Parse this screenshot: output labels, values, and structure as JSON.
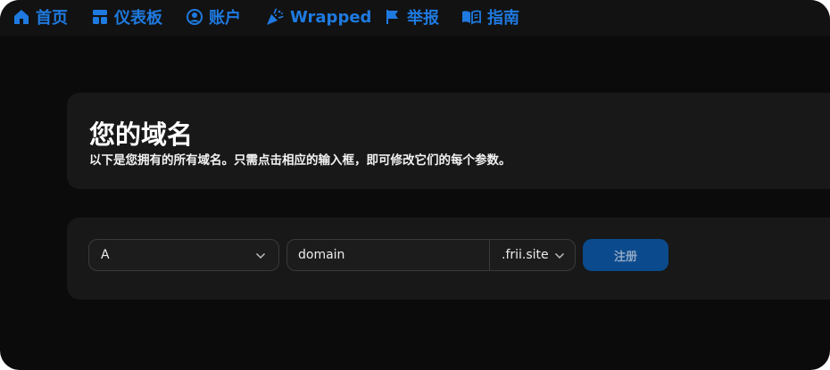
{
  "nav": {
    "items": [
      {
        "label": "首页",
        "icon": "home-icon"
      },
      {
        "label": "仪表板",
        "icon": "dashboard-icon"
      },
      {
        "label": "账户",
        "icon": "account-icon"
      },
      {
        "label": "Wrapped",
        "icon": "party-popper-icon"
      },
      {
        "label": "举报",
        "icon": "flag-icon"
      },
      {
        "label": "指南",
        "icon": "book-icon"
      }
    ]
  },
  "header": {
    "title": "您的域名",
    "description": "以下是您拥有的所有域名。只需点击相应的输入框，即可修改它们的每个参数。"
  },
  "form": {
    "record_type": "A",
    "domain_value": "domain",
    "tld": ".frii.site",
    "register_label": "注册"
  },
  "colors": {
    "accent": "#1f7ae0",
    "button": "#0b4a8c",
    "background": "#0b0b0b",
    "card": "#181818"
  }
}
